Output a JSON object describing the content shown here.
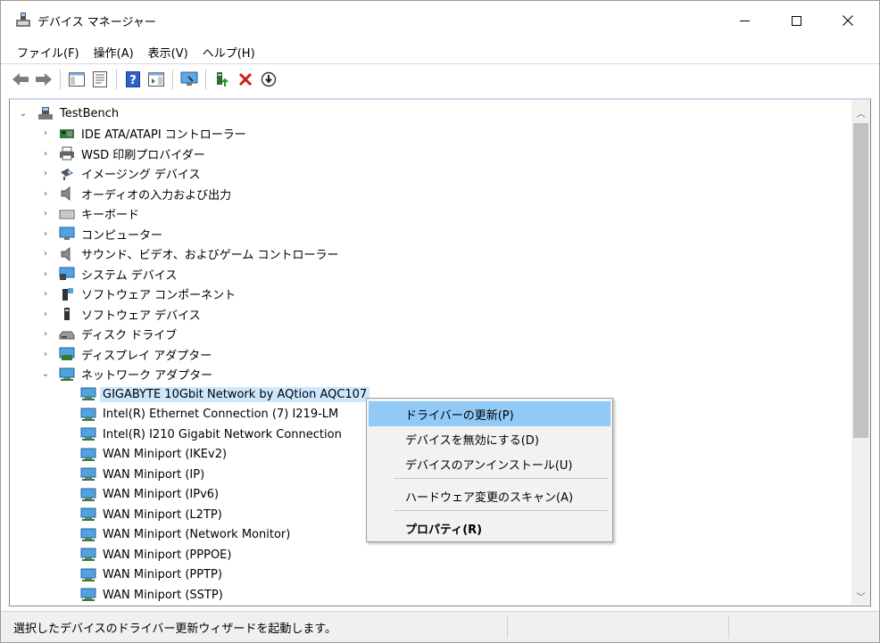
{
  "window": {
    "title": "デバイス マネージャー"
  },
  "menu": [
    "ファイル(F)",
    "操作(A)",
    "表示(V)",
    "ヘルプ(H)"
  ],
  "toolbar": {
    "buttons": [
      "back-icon",
      "forward-icon",
      "show-hide-console-tree-icon",
      "properties-icon",
      "help-icon",
      "action-pane-icon",
      "scan-hardware-icon",
      "update-driver-icon",
      "uninstall-icon",
      "disable-icon"
    ]
  },
  "tree": {
    "root": "TestBench",
    "categories": [
      "IDE ATA/ATAPI コントローラー",
      "WSD 印刷プロバイダー",
      "イメージング デバイス",
      "オーディオの入力および出力",
      "キーボード",
      "コンピューター",
      "サウンド、ビデオ、およびゲーム コントローラー",
      "システム デバイス",
      "ソフトウェア コンポーネント",
      "ソフトウェア デバイス",
      "ディスク ドライブ",
      "ディスプレイ アダプター"
    ],
    "expanded_category": "ネットワーク アダプター",
    "network_devices": [
      "GIGABYTE 10Gbit Network by AQtion AQC107",
      "Intel(R) Ethernet Connection (7) I219-LM",
      "Intel(R) I210 Gigabit Network Connection",
      "WAN Miniport (IKEv2)",
      "WAN Miniport (IP)",
      "WAN Miniport (IPv6)",
      "WAN Miniport (L2TP)",
      "WAN Miniport (Network Monitor)",
      "WAN Miniport (PPPOE)",
      "WAN Miniport (PPTP)",
      "WAN Miniport (SSTP)"
    ]
  },
  "context_menu": {
    "items": [
      "ドライバーの更新(P)",
      "デバイスを無効にする(D)",
      "デバイスのアンインストール(U)",
      "ハードウェア変更のスキャン(A)",
      "プロパティ(R)"
    ]
  },
  "status": {
    "text": "選択したデバイスのドライバー更新ウィザードを起動します。"
  }
}
